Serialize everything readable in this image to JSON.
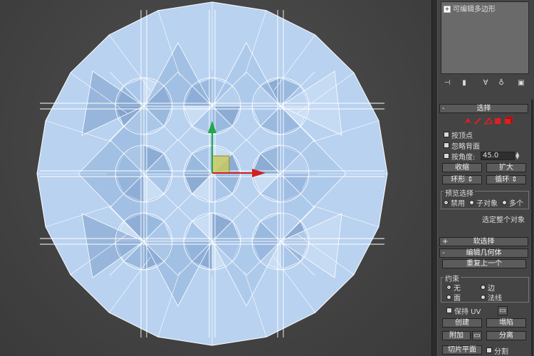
{
  "modifier_stack": {
    "item": "可编辑多边形"
  },
  "stack_icons": [
    "pin-stack",
    "show-end-result",
    "make-unique",
    "remove-modifier",
    "configure-modifier-sets"
  ],
  "selection": {
    "header": "选择",
    "by_vertex": "按顶点",
    "ignore_backfacing": "忽略背面",
    "by_angle": "按角度:",
    "angle_value": "45.0",
    "shrink": "收缩",
    "grow": "扩大",
    "ring": "环形",
    "loop": "循环",
    "preview_group": "预览选择",
    "preview_options": [
      "禁用",
      "子对象",
      "多个"
    ],
    "preview_selected": 0,
    "status": "选定整个对象"
  },
  "soft_selection": {
    "header": "软选择"
  },
  "edit_geometry": {
    "header": "编辑几何体",
    "repeat_last": "重复上一个",
    "constraints_group": "约束",
    "constraints": [
      "无",
      "边",
      "面",
      "法线"
    ],
    "constraint_selected": 0,
    "preserve_uv": "保持 UV",
    "create": "创建",
    "collapse": "塌陷",
    "attach": "附加",
    "detach": "分离",
    "slice_plane": "切片平面",
    "split": "分割"
  },
  "colors": {
    "mesh_fill": "#b9d2f0",
    "gizmo_y": "#1fa84a",
    "gizmo_x": "#d02020",
    "gizmo_plane": "#c8c860",
    "subobj_red": "#e02020"
  }
}
